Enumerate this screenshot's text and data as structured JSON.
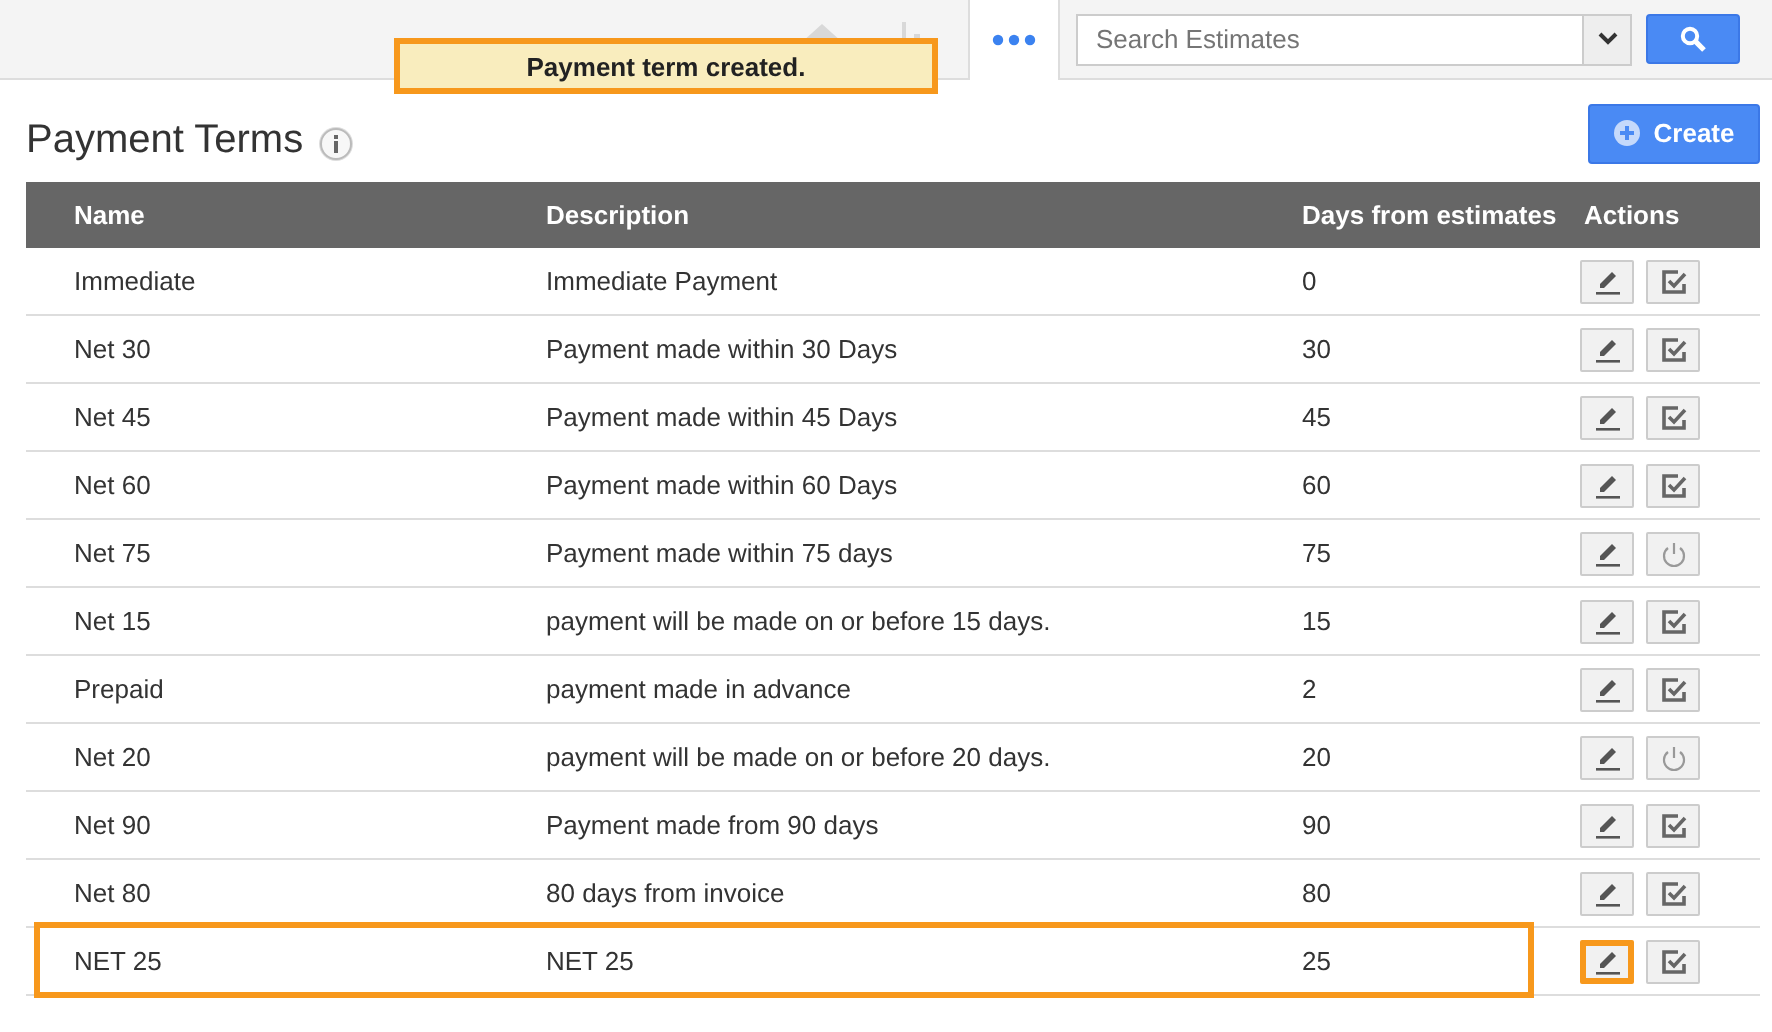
{
  "top_bar": {
    "search": {
      "placeholder": "Search Estimates"
    }
  },
  "toast": "Payment term created.",
  "page": {
    "title": "Payment Terms",
    "create_button": "Create"
  },
  "table": {
    "columns": [
      "Name",
      "Description",
      "Days from estimates",
      "Actions"
    ],
    "rows": [
      {
        "name": "Immediate",
        "description": "Immediate Payment",
        "days": "0",
        "active": true,
        "highlighted": false
      },
      {
        "name": "Net 30",
        "description": "Payment made within 30 Days",
        "days": "30",
        "active": true,
        "highlighted": false
      },
      {
        "name": "Net 45",
        "description": "Payment made within 45 Days",
        "days": "45",
        "active": true,
        "highlighted": false
      },
      {
        "name": "Net 60",
        "description": "Payment made within 60 Days",
        "days": "60",
        "active": true,
        "highlighted": false
      },
      {
        "name": "Net 75",
        "description": "Payment made within 75 days",
        "days": "75",
        "active": false,
        "highlighted": false
      },
      {
        "name": "Net 15",
        "description": "payment will be made on or before 15 days.",
        "days": "15",
        "active": true,
        "highlighted": false
      },
      {
        "name": "Prepaid",
        "description": "payment made in advance",
        "days": "2",
        "active": true,
        "highlighted": false
      },
      {
        "name": "Net 20",
        "description": "payment will be made on or before 20 days.",
        "days": "20",
        "active": false,
        "highlighted": false
      },
      {
        "name": "Net 90",
        "description": "Payment made from 90 days",
        "days": "90",
        "active": true,
        "highlighted": false
      },
      {
        "name": "Net 80",
        "description": "80 days from invoice",
        "days": "80",
        "active": true,
        "highlighted": false
      },
      {
        "name": "NET 25",
        "description": "NET 25",
        "days": "25",
        "active": true,
        "highlighted": true
      }
    ]
  }
}
